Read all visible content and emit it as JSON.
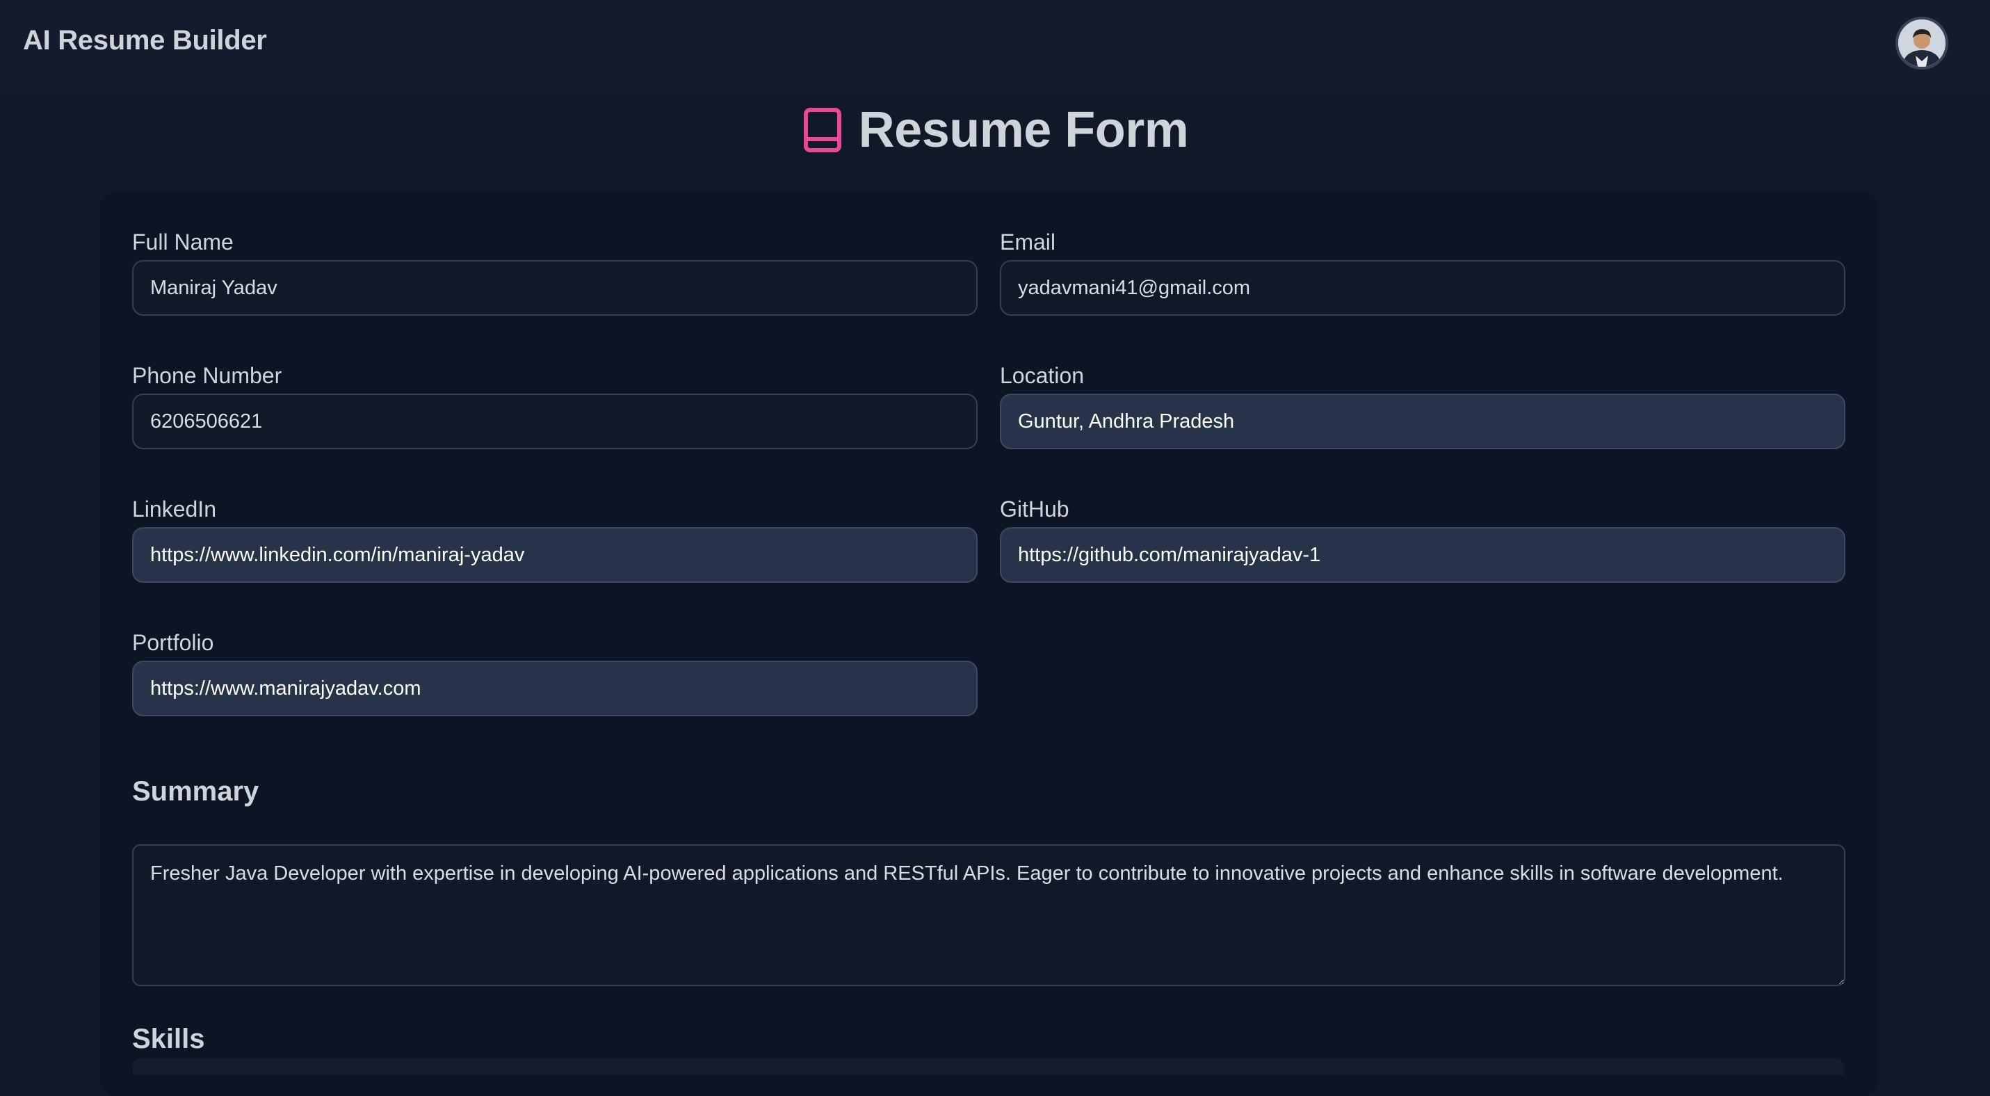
{
  "app": {
    "title": "AI Resume Builder"
  },
  "page": {
    "title": "Resume Form",
    "title_icon": "book-icon",
    "accent": "#ec4899"
  },
  "colors": {
    "background": "#111827",
    "card": "#0d1424",
    "input_filled": "#273349"
  },
  "fields": {
    "full_name": {
      "label": "Full Name",
      "value": "Maniraj Yadav"
    },
    "email": {
      "label": "Email",
      "value": "yadavmani41@gmail.com"
    },
    "phone": {
      "label": "Phone Number",
      "value": "6206506621"
    },
    "location": {
      "label": "Location",
      "value": "Guntur, Andhra Pradesh"
    },
    "linkedin": {
      "label": "LinkedIn",
      "value": "https://www.linkedin.com/in/maniraj-yadav"
    },
    "github": {
      "label": "GitHub",
      "value": "https://github.com/manirajyadav-1"
    },
    "portfolio": {
      "label": "Portfolio",
      "value": "https://www.manirajyadav.com"
    }
  },
  "summary": {
    "heading": "Summary",
    "value": "Fresher Java Developer with expertise in developing AI-powered applications and RESTful APIs. Eager to contribute to innovative projects and enhance skills in software development."
  },
  "skills": {
    "heading": "Skills"
  }
}
